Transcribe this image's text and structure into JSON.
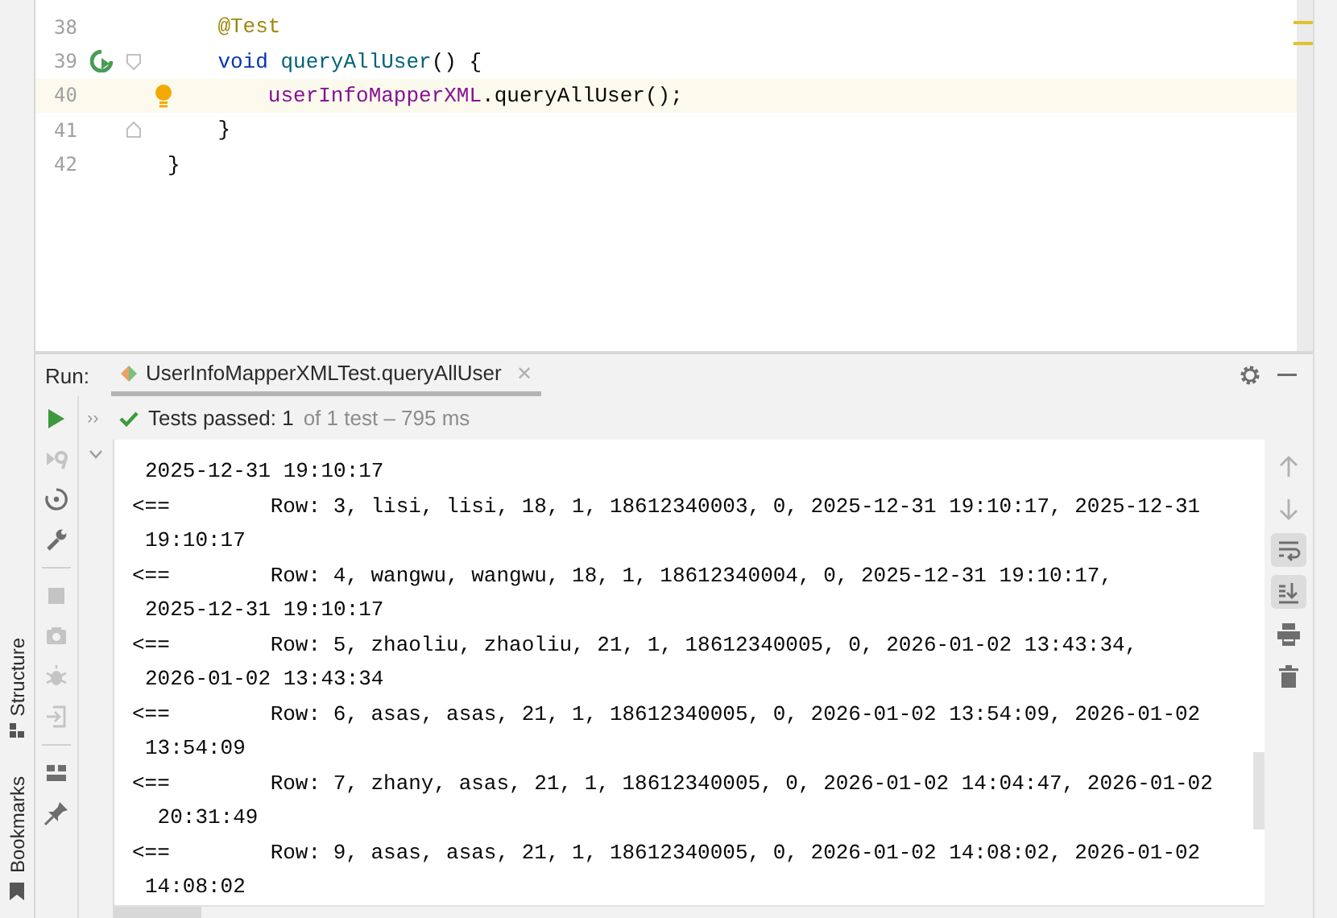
{
  "side_strip": {
    "items": [
      {
        "label": "Structure",
        "kind": "structure"
      },
      {
        "label": "Bookmarks",
        "kind": "bookmarks"
      }
    ]
  },
  "editor": {
    "lines": [
      {
        "number": "38",
        "current": false,
        "run_marker": false,
        "fold_start": false,
        "fold_end": false,
        "intention": false,
        "tokens": [
          {
            "text": "    @Test",
            "kind": "annotation"
          }
        ]
      },
      {
        "number": "39",
        "current": false,
        "run_marker": true,
        "fold_start": true,
        "fold_end": false,
        "intention": false,
        "tokens": [
          {
            "text": "    void",
            "kind": "keyword"
          },
          {
            "text": " queryAllUser",
            "kind": "method"
          },
          {
            "text": "() {",
            "kind": "plain"
          }
        ]
      },
      {
        "number": "40",
        "current": true,
        "run_marker": false,
        "fold_start": false,
        "fold_end": false,
        "intention": true,
        "tokens": [
          {
            "text": "        userInfoMapperXML",
            "kind": "field"
          },
          {
            "text": ".queryAllUser();",
            "kind": "plain"
          }
        ]
      },
      {
        "number": "41",
        "current": false,
        "run_marker": false,
        "fold_start": false,
        "fold_end": true,
        "intention": false,
        "tokens": [
          {
            "text": "    }",
            "kind": "plain"
          }
        ]
      },
      {
        "number": "42",
        "current": false,
        "run_marker": false,
        "fold_start": false,
        "fold_end": false,
        "intention": false,
        "tokens": [
          {
            "text": "}",
            "kind": "plain"
          }
        ]
      }
    ]
  },
  "run": {
    "label": "Run:",
    "tabs": [
      {
        "title": "UserInfoMapperXMLTest.queryAllUser",
        "close": "✕",
        "selected": true
      }
    ],
    "left_tools": [
      {
        "kind": "run",
        "disabled": false
      },
      {
        "kind": "rerun-failed",
        "disabled": true
      },
      {
        "kind": "toggle",
        "disabled": false
      },
      {
        "kind": "wrench",
        "disabled": false
      },
      {
        "kind": "separator"
      },
      {
        "kind": "stop",
        "disabled": true
      },
      {
        "kind": "camera",
        "disabled": true
      },
      {
        "kind": "bug",
        "disabled": true
      },
      {
        "kind": "exit",
        "disabled": true
      },
      {
        "kind": "separator"
      },
      {
        "kind": "layout",
        "disabled": false
      },
      {
        "kind": "pin",
        "disabled": false
      }
    ],
    "status": {
      "expander": "››",
      "summary": "Tests passed: 1",
      "detail": "of 1 test – 795 ms"
    },
    "right_tools": [
      {
        "kind": "up",
        "selected": false
      },
      {
        "kind": "down",
        "selected": false
      },
      {
        "kind": "wrap",
        "selected": true
      },
      {
        "kind": "scroll-end",
        "selected": true
      },
      {
        "kind": "print",
        "selected": false
      },
      {
        "kind": "trash",
        "selected": false
      }
    ],
    "console": [
      {
        "kind": "wrap",
        "text": "2025-12-31 19:10:17"
      },
      {
        "kind": "row",
        "text": "<==        Row: 3, lisi, lisi, 18, 1, 18612340003, 0, 2025-12-31 19:10:17, 2025-12-31"
      },
      {
        "kind": "wrap",
        "text": "19:10:17"
      },
      {
        "kind": "row",
        "text": "<==        Row: 4, wangwu, wangwu, 18, 1, 18612340004, 0, 2025-12-31 19:10:17,"
      },
      {
        "kind": "wrap",
        "text": "2025-12-31 19:10:17"
      },
      {
        "kind": "row",
        "text": "<==        Row: 5, zhaoliu, zhaoliu, 21, 1, 18612340005, 0, 2026-01-02 13:43:34,"
      },
      {
        "kind": "wrap",
        "text": "2026-01-02 13:43:34"
      },
      {
        "kind": "row",
        "text": "<==        Row: 6, asas, asas, 21, 1, 18612340005, 0, 2026-01-02 13:54:09, 2026-01-02"
      },
      {
        "kind": "wrap",
        "text": "13:54:09"
      },
      {
        "kind": "row",
        "text": "<==        Row: 7, zhany, asas, 21, 1, 18612340005, 0, 2026-01-02 14:04:47, 2026-01-02"
      },
      {
        "kind": "wrap",
        "text": " 20:31:49"
      },
      {
        "kind": "row",
        "text": "<==        Row: 9, asas, asas, 21, 1, 18612340005, 0, 2026-01-02 14:08:02, 2026-01-02"
      },
      {
        "kind": "wrap",
        "text": "14:08:02"
      }
    ]
  }
}
